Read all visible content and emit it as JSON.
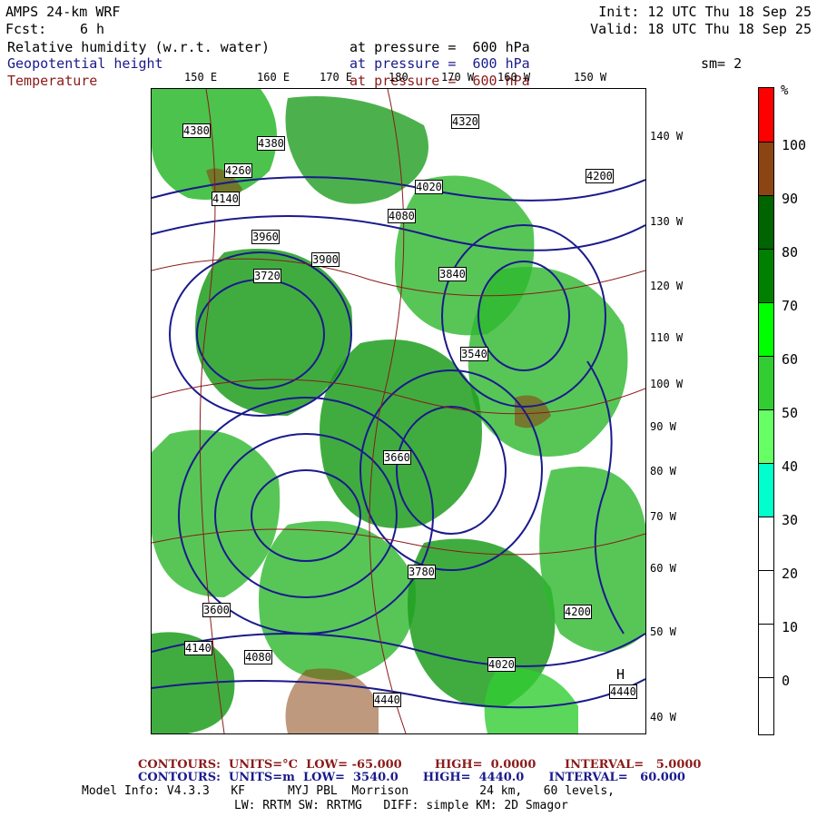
{
  "header": {
    "model": "AMPS 24-km WRF",
    "fcst_label": "Fcst:",
    "fcst_value": "6 h",
    "init": "Init: 12 UTC Thu 18 Sep 25",
    "valid": "Valid: 18 UTC Thu 18 Sep 25",
    "fields": [
      {
        "name": "Relative humidity (w.r.t. water)",
        "level": "at pressure =  600 hPa",
        "color": "#000000"
      },
      {
        "name": "Geopotential height",
        "level": "at pressure =  600 hPa",
        "color": "#1a1a8c"
      },
      {
        "name": "Temperature",
        "level": "at pressure =  600 hPa",
        "color": "#8b1a1a"
      }
    ],
    "smoothing": "sm= 2"
  },
  "map": {
    "top_lon_labels": [
      "150 E",
      "160 E",
      "170 E",
      "180",
      "170 W",
      "160 W",
      "150 W"
    ],
    "right_lon_labels": [
      "140 W",
      "130 W",
      "120 W",
      "110 W",
      "100 W",
      "90 W",
      "80 W",
      "70 W",
      "60 W",
      "50 W",
      "40 W"
    ],
    "height_labels": [
      "4320",
      "4380",
      "4260",
      "4380",
      "4140",
      "4020",
      "4200",
      "4080",
      "3960",
      "3900",
      "3720",
      "3840",
      "3660",
      "3540",
      "3780",
      "3600",
      "4200",
      "4140",
      "4020",
      "4080",
      "4440"
    ],
    "high_label": "H",
    "high_value": "4440"
  },
  "colorbar": {
    "unit": "%",
    "tick_labels": [
      "100",
      "90",
      "80",
      "70",
      "60",
      "50",
      "40",
      "30",
      "20",
      "10",
      "0"
    ],
    "segments": [
      {
        "color": "#ff0000"
      },
      {
        "color": "#8b4513"
      },
      {
        "color": "#006400"
      },
      {
        "color": "#008000"
      },
      {
        "color": "#00ff00"
      },
      {
        "color": "#32cd32"
      },
      {
        "color": "#66ff66"
      },
      {
        "color": "#00ffcc"
      },
      {
        "color": "#ffffff"
      },
      {
        "color": "#ffffff"
      },
      {
        "color": "#ffffff"
      },
      {
        "color": "#ffffff"
      }
    ]
  },
  "footer": {
    "temp_contours": "CONTOURS:  UNITS=°C  LOW= -65.000        HIGH=  0.0000       INTERVAL=   5.0000",
    "height_contours": "CONTOURS:  UNITS=m  LOW=  3540.0      HIGH=  4440.0      INTERVAL=   60.000",
    "model_info": "Model Info: V4.3.3   KF      MYJ PBL  Morrison          24 km,   60 levels,",
    "physics": "LW: RRTM SW: RRTMG   DIFF: simple KM: 2D Smagor"
  }
}
